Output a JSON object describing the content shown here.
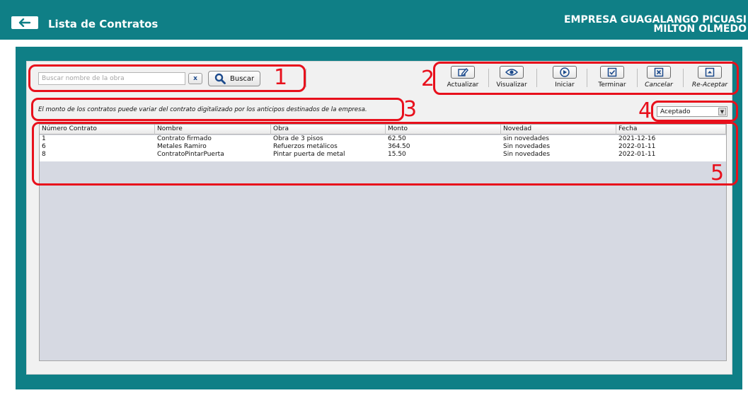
{
  "header": {
    "title": "Lista de Contratos",
    "company_line1": "EMPRESA GUAGALANGO PICUASI",
    "company_line2": "MILTON OLMEDO",
    "back_icon": "arrow-left-icon"
  },
  "search": {
    "placeholder": "Buscar nombre de la obra",
    "value": "",
    "clear_label": "x",
    "button_label": "Buscar"
  },
  "toolbar": {
    "actualizar": "Actualizar",
    "visualizar": "Visualizar",
    "iniciar": "Iniciar",
    "terminar": "Terminar",
    "cancelar": "Cancelar",
    "reaceptar": "Re-Aceptar"
  },
  "notice": "El monto de los contratos puede variar del contrato digitalizado por los anticipos destinados de la empresa.",
  "filter": {
    "selected": "Aceptado"
  },
  "table": {
    "columns": [
      "Número Contrato",
      "Nombre",
      "Obra",
      "Monto",
      "Novedad",
      "Fecha"
    ],
    "rows": [
      [
        "1",
        "Contrato firmado",
        "Obra de 3 pisos",
        "62.50",
        "sin novedades",
        "2021-12-16"
      ],
      [
        "6",
        "Metales Ramiro",
        "Refuerzos metálicos",
        "364.50",
        "Sin novedades",
        "2022-01-11"
      ],
      [
        "8",
        "ContratoPintarPuerta",
        "Pintar puerta de metal",
        "15.50",
        "Sin novedades",
        "2022-01-11"
      ]
    ]
  },
  "annotations": {
    "n1": "1",
    "n2": "2",
    "n3": "3",
    "n4": "4",
    "n5": "5",
    "color": "#e8101c"
  },
  "colors": {
    "teal": "#0f7f86",
    "panel": "#f1f1f1",
    "table_bg": "#d6d9e2"
  }
}
